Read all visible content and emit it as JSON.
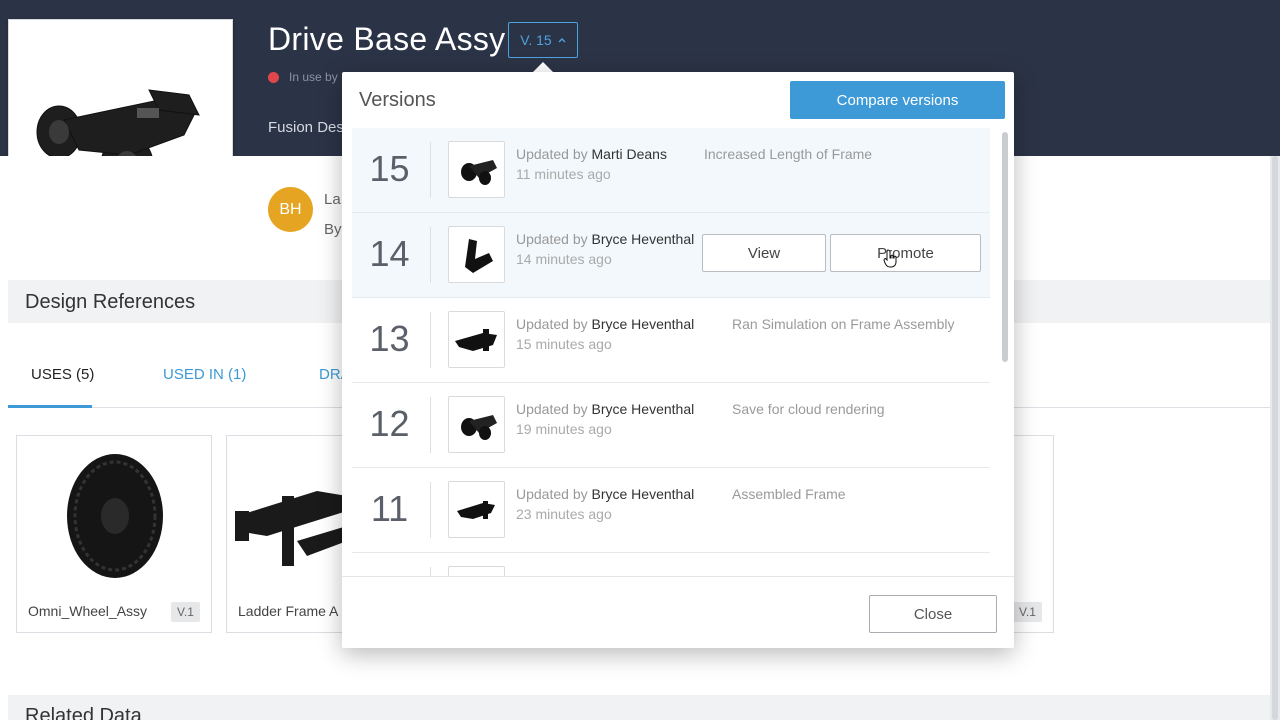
{
  "header": {
    "title": "Drive Base Assy",
    "version_label": "V. 15",
    "in_use_text": "In use by",
    "subtitle": "Fusion Des"
  },
  "activity": {
    "avatar_initials": "BH",
    "last_line": "La",
    "by_line": "By"
  },
  "sections": {
    "design_references": "Design References",
    "related_data": "Related Data"
  },
  "tabs": [
    {
      "label": "USES (5)",
      "active": true
    },
    {
      "label": "USED IN (1)",
      "active": false
    },
    {
      "label": "DRA",
      "active": false
    }
  ],
  "references": [
    {
      "name": "Omni_Wheel_Assy",
      "version": "V.1"
    },
    {
      "name": "Ladder Frame A",
      "version": ""
    },
    {
      "name": "",
      "version": "V.1"
    }
  ],
  "versions_modal": {
    "title": "Versions",
    "compare_button": "Compare versions",
    "close_button": "Close",
    "view_button": "View",
    "promote_button": "Promote",
    "updated_by_prefix": "Updated by",
    "rows": [
      {
        "number": "15",
        "user": "Marti Deans",
        "time": "11 minutes ago",
        "description": "Increased Length of Frame"
      },
      {
        "number": "14",
        "user": "Bryce Heventhal",
        "time": "14 minutes ago",
        "description": ""
      },
      {
        "number": "13",
        "user": "Bryce Heventhal",
        "time": "15 minutes ago",
        "description": "Ran Simulation on Frame Assembly"
      },
      {
        "number": "12",
        "user": "Bryce Heventhal",
        "time": "19 minutes ago",
        "description": "Save for cloud rendering"
      },
      {
        "number": "11",
        "user": "Bryce Heventhal",
        "time": "23 minutes ago",
        "description": "Assembled Frame"
      }
    ]
  },
  "colors": {
    "header_bg": "#2b3346",
    "accent": "#3d9ad6",
    "avatar": "#e6a423",
    "in_use_dot": "#e0474c"
  }
}
